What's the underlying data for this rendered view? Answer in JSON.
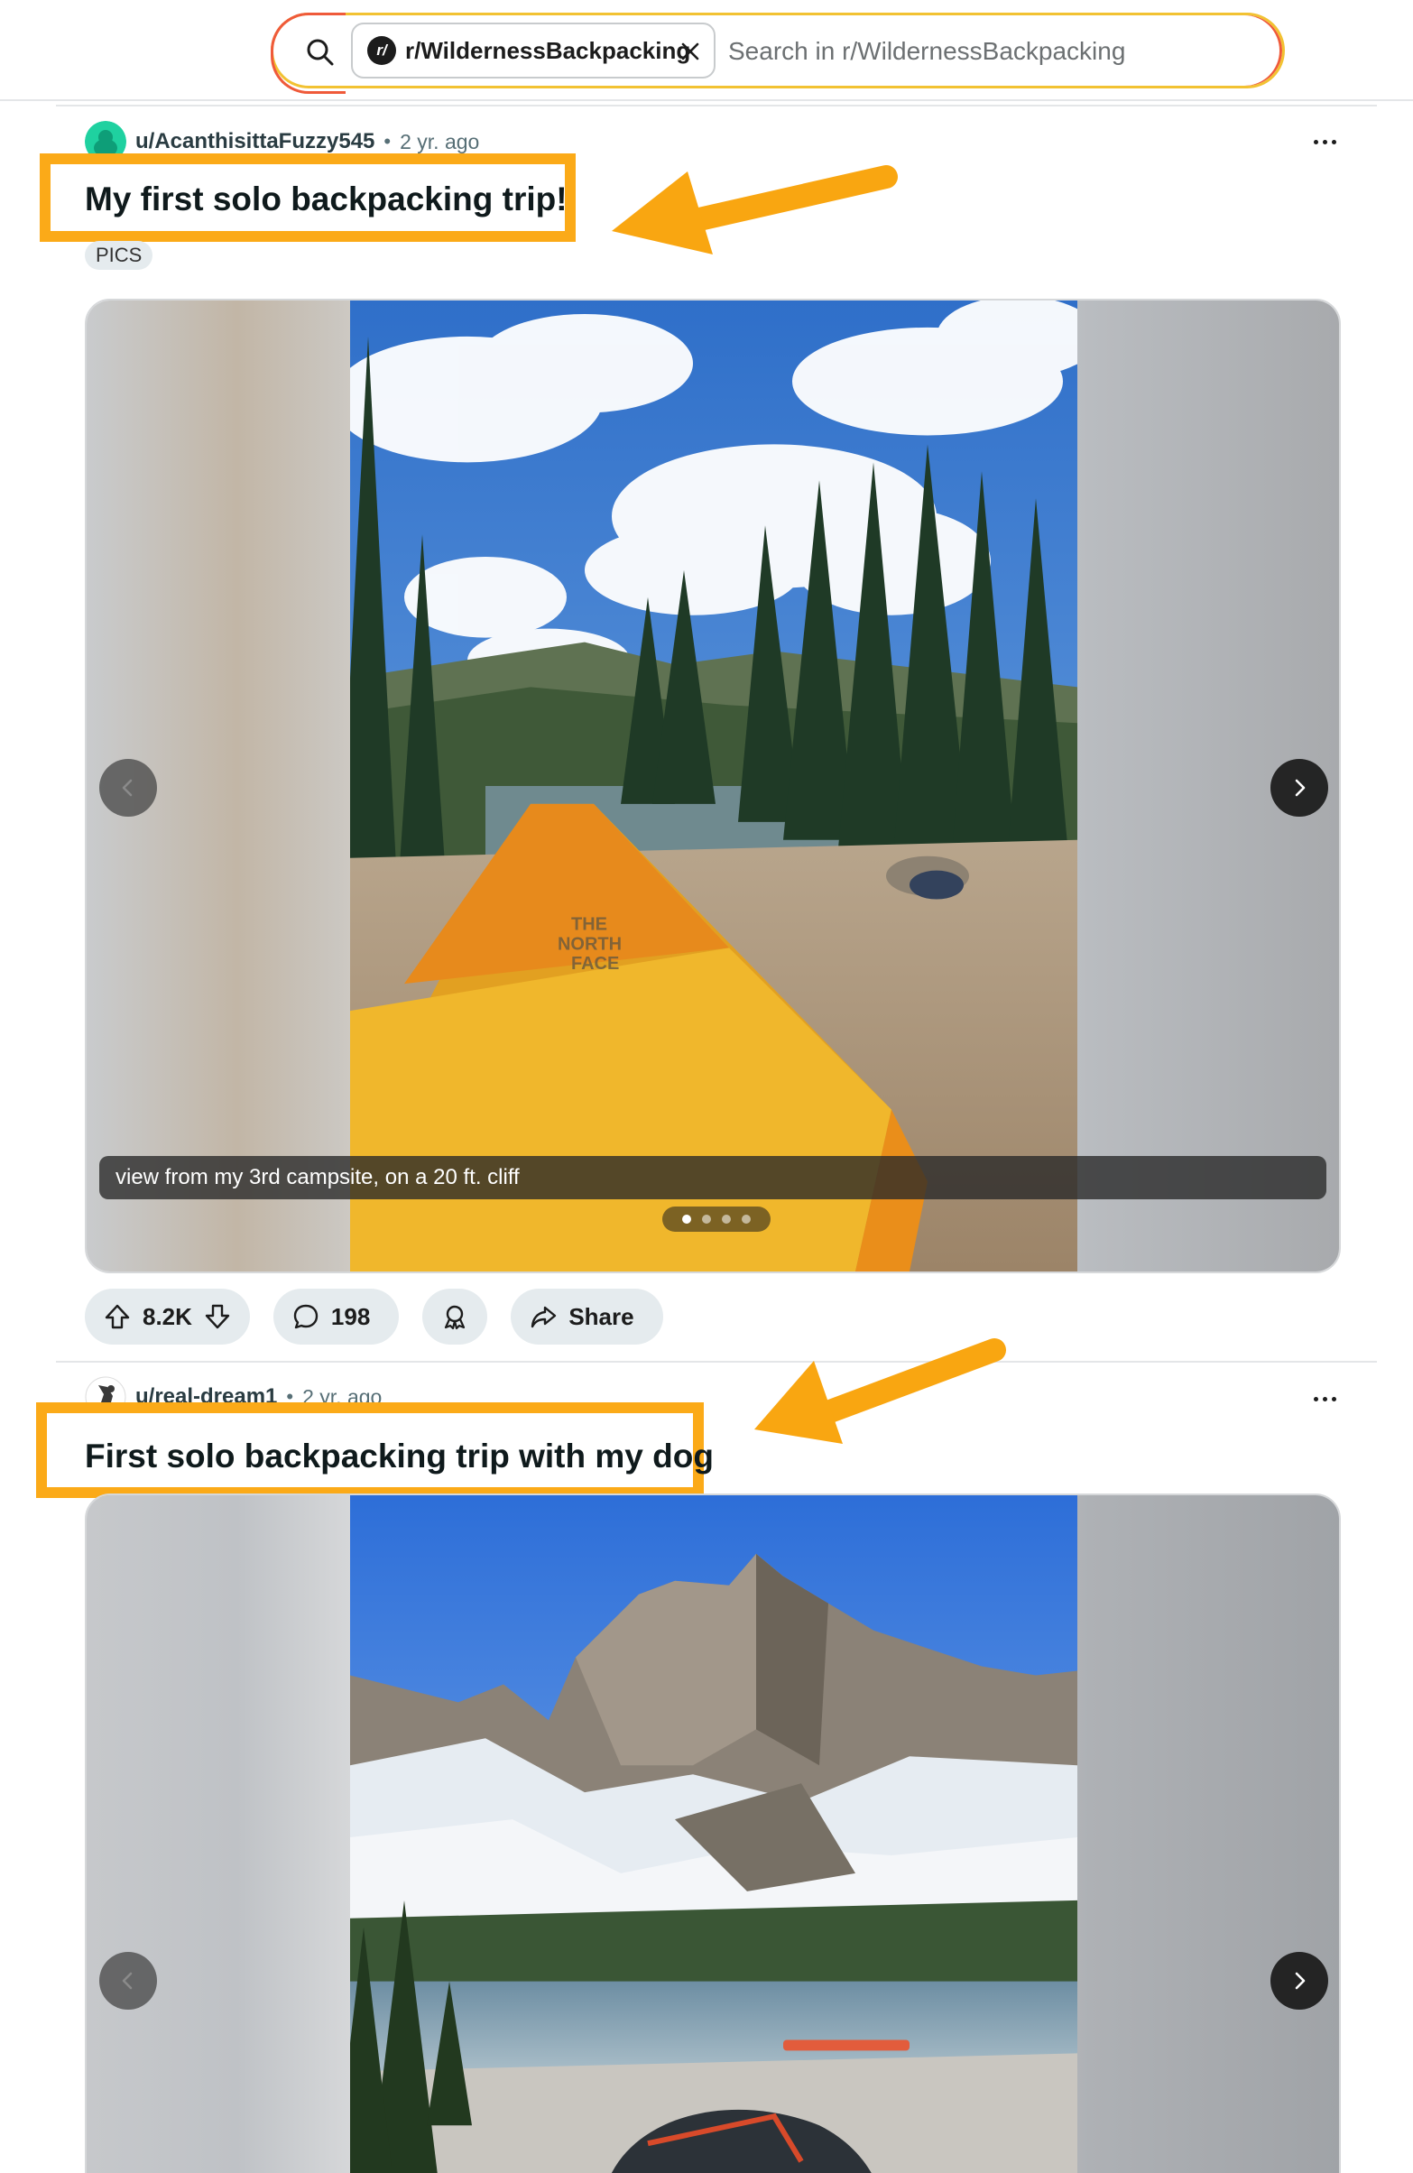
{
  "search": {
    "subreddit_chip": "r/WildernessBackpacking",
    "subreddit_icon_letter": "r/",
    "placeholder": "Search in r/WildernessBackpacking"
  },
  "posts": [
    {
      "author": "u/AcanthisittaFuzzy545",
      "separator": "•",
      "time": "2 yr. ago",
      "title": "My first solo backpacking trip!",
      "flair": "PICS",
      "caption": "view from my 3rd campsite, on a 20 ft. cliff",
      "gallery_count": 4,
      "gallery_active": 1,
      "upvotes": "8.2K",
      "comments": "198",
      "share_label": "Share",
      "avatar_color": "#1fd1a0"
    },
    {
      "author": "u/real-dream1",
      "separator": "•",
      "time": "2 yr. ago",
      "title": "First solo backpacking trip with my dog",
      "avatar_color": "#ffffff"
    }
  ],
  "colors": {
    "highlight_box": "#fbaa18",
    "arrow": "#f9a611",
    "search_border_left": "#ef5a3a",
    "search_border_right": "#f2c232"
  },
  "icons": [
    "search-icon",
    "close-icon",
    "upvote-icon",
    "downvote-icon",
    "comment-icon",
    "award-icon",
    "share-icon",
    "chevron-left-icon",
    "chevron-right-icon",
    "overflow-menu-icon"
  ]
}
